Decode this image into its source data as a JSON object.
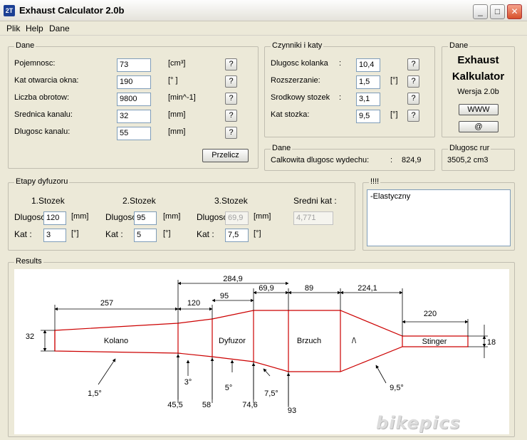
{
  "window": {
    "app_icon_text": "2T",
    "title": "Exhaust Calculator 2.0b"
  },
  "menu": [
    "Plik",
    "Help",
    "Dane"
  ],
  "dane": {
    "title": "Dane",
    "rows": [
      {
        "label": "Pojemnosc:",
        "value": "73",
        "unit": "[cm³]"
      },
      {
        "label": "Kat otwarcia okna:",
        "value": "190",
        "unit": "[° ]"
      },
      {
        "label": "Liczba obrotow:",
        "value": "9800",
        "unit": "[min^-1]"
      },
      {
        "label": "Srednica kanalu:",
        "value": "32",
        "unit": "[mm]"
      },
      {
        "label": "Dlugosc kanalu:",
        "value": "55",
        "unit": "[mm]"
      }
    ],
    "help_label": "?",
    "calc_button": "Przelicz"
  },
  "czynniki": {
    "title": "Czynniki i katy",
    "rows": [
      {
        "label": "Dlugosc kolanka",
        "colon": ":",
        "value": "10,4",
        "unit": ""
      },
      {
        "label": "Rozszerzanie:",
        "colon": "",
        "value": "1,5",
        "unit": "[°]"
      },
      {
        "label": "Srodkowy stozek",
        "colon": ":",
        "value": "3,1",
        "unit": ""
      },
      {
        "label": "Kat stozka:",
        "colon": "",
        "value": "9,5",
        "unit": "[°]"
      }
    ]
  },
  "about": {
    "title": "Dane",
    "line1": "Exhaust",
    "line2": "Kalkulator",
    "version": "Wersja  2.0b",
    "www_button": "WWW",
    "at_button": "@"
  },
  "total": {
    "title": "Dane",
    "label": "Calkowita dlugosc wydechu:",
    "colon": ":",
    "value": "824,9"
  },
  "pipe": {
    "title": "Dlugosc rur",
    "value": "3505,2 cm3"
  },
  "etapy": {
    "title": "Etapy dyfuzoru",
    "stages": [
      {
        "header": "1.Stozek",
        "dl_label": "Dlugosc",
        "dl_value": "120",
        "dl_unit": "[mm]",
        "kat_label": "Kat :",
        "kat_value": "3",
        "kat_unit": "[°]"
      },
      {
        "header": "2.Stozek",
        "dl_label": "Dlugosc",
        "dl_value": "95",
        "dl_unit": "[mm]",
        "kat_label": "Kat :",
        "kat_value": "5",
        "kat_unit": "[°]"
      },
      {
        "header": "3.Stozek",
        "dl_label": "Dlugosc",
        "dl_value": "69,9",
        "dl_unit": "[mm]",
        "kat_label": "Kat :",
        "kat_value": "7,5",
        "kat_unit": "[°]"
      }
    ],
    "avg_header": "Sredni kat  :",
    "avg_value": "4,771"
  },
  "notes": {
    "title": "!!!!",
    "text": "-Elastyczny"
  },
  "results": {
    "title": "Results",
    "dims": [
      "284,9",
      "257",
      "120",
      "95",
      "69,9",
      "89",
      "224,1",
      "220"
    ],
    "sections": [
      "Kolano",
      "Dyfuzor",
      "Brzuch",
      "/\\",
      "Stinger"
    ],
    "left_diameter": "32",
    "right_diameter": "18",
    "angles": [
      "1,5°",
      "3°",
      "5°",
      "7,5°",
      "9,5°"
    ],
    "stations": [
      "45,5",
      "58",
      "74,6",
      "93"
    ]
  },
  "colors": {
    "outline": "#cc0000",
    "window_bg": "#ece9d8",
    "field_border": "#7f9db9"
  },
  "watermark": "bikepics"
}
